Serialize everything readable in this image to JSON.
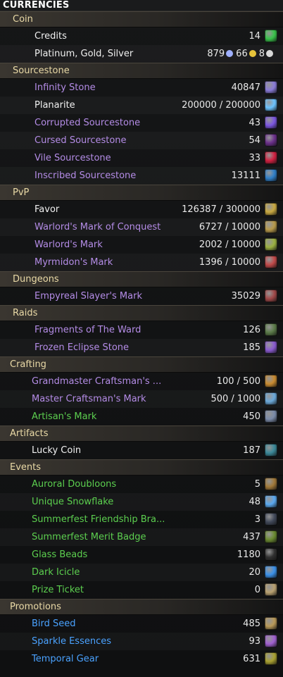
{
  "title": "CURRENCIES",
  "sections": {
    "coin": {
      "header": "Coin",
      "credits": {
        "label": "Credits",
        "value": "14",
        "icon": "green-gem-icon",
        "color": "#38c44a"
      },
      "money": {
        "label": "Platinum, Gold, Silver",
        "platinum": "879",
        "gold": "66",
        "silver": "8"
      }
    },
    "sourcestone": {
      "header": "Sourcestone",
      "items": [
        {
          "label": "Infinity Stone",
          "value": "40847",
          "icon": "infinity-stone-icon",
          "color": "#8a7bd8"
        },
        {
          "label": "Planarite",
          "value": "200000 / 200000",
          "icon": "planarite-icon",
          "color": "#6cc3ff"
        },
        {
          "label": "Corrupted Sourcestone",
          "value": "43",
          "icon": "corrupted-sourcestone-icon",
          "color": "#7a55e0"
        },
        {
          "label": "Cursed Sourcestone",
          "value": "54",
          "icon": "cursed-sourcestone-icon",
          "color": "#6a2f8a"
        },
        {
          "label": "Vile Sourcestone",
          "value": "33",
          "icon": "vile-sourcestone-icon",
          "color": "#d02040"
        },
        {
          "label": "Inscribed Sourcestone",
          "value": "13111",
          "icon": "inscribed-sourcestone-icon",
          "color": "#2f7fc8"
        }
      ]
    },
    "pvp": {
      "header": "PvP",
      "items": [
        {
          "label": "Favor",
          "value": "126387 / 300000",
          "icon": "favor-icon",
          "color": "#c8a840"
        },
        {
          "label": "Warlord's Mark of Conquest",
          "value": "6727 / 10000",
          "icon": "conquest-mark-icon",
          "color": "#b89a4a"
        },
        {
          "label": "Warlord's Mark",
          "value": "2002 / 10000",
          "icon": "warlord-mark-icon",
          "color": "#9bb040"
        },
        {
          "label": "Myrmidon's Mark",
          "value": "1396 / 10000",
          "icon": "myrmidon-mark-icon",
          "color": "#c04848"
        }
      ]
    },
    "dungeons": {
      "header": "Dungeons",
      "items": [
        {
          "label": "Empyreal Slayer's Mark",
          "value": "35029",
          "icon": "slayer-mark-icon",
          "color": "#a04848"
        }
      ]
    },
    "raids": {
      "header": "Raids",
      "items": [
        {
          "label": "Fragments of The Ward",
          "value": "126",
          "icon": "ward-fragment-icon",
          "color": "#5a7a48"
        },
        {
          "label": "Frozen Eclipse Stone",
          "value": "185",
          "icon": "eclipse-stone-icon",
          "color": "#8a5ad0"
        }
      ]
    },
    "crafting": {
      "header": "Crafting",
      "items": [
        {
          "label": "Grandmaster Craftsman's ...",
          "value": "100 / 500",
          "icon": "grandmaster-mark-icon",
          "color": "#c88a30"
        },
        {
          "label": "Master Craftsman's Mark",
          "value": "500 / 1000",
          "icon": "master-mark-icon",
          "color": "#6aa8d8"
        },
        {
          "label": "Artisan's Mark",
          "value": "450",
          "icon": "artisan-mark-icon",
          "color": "#7a8aa8"
        }
      ]
    },
    "artifacts": {
      "header": "Artifacts",
      "items": [
        {
          "label": "Lucky Coin",
          "value": "187",
          "icon": "lucky-coin-icon",
          "color": "#3a8898"
        }
      ]
    },
    "events": {
      "header": "Events",
      "items": [
        {
          "label": "Auroral Doubloons",
          "value": "5",
          "icon": "doubloon-icon",
          "color": "#a07838"
        },
        {
          "label": "Unique Snowflake",
          "value": "48",
          "icon": "snowflake-icon",
          "color": "#5aa8f0"
        },
        {
          "label": "Summerfest Friendship Bra...",
          "value": "3",
          "icon": "friendship-bracelet-icon",
          "color": "#404858"
        },
        {
          "label": "Summerfest Merit Badge",
          "value": "437",
          "icon": "merit-badge-icon",
          "color": "#6a8a30"
        },
        {
          "label": "Glass Beads",
          "value": "1180",
          "icon": "glass-beads-icon",
          "color": "#303030"
        },
        {
          "label": "Dark Icicle",
          "value": "20",
          "icon": "icicle-icon",
          "color": "#3a90e8"
        },
        {
          "label": "Prize Ticket",
          "value": "0",
          "icon": "ticket-icon",
          "color": "#b8a070"
        }
      ]
    },
    "promotions": {
      "header": "Promotions",
      "items": [
        {
          "label": "Bird Seed",
          "value": "485",
          "icon": "bird-seed-icon",
          "color": "#b89858"
        },
        {
          "label": "Sparkle Essences",
          "value": "93",
          "icon": "sparkle-essence-icon",
          "color": "#a060d0"
        },
        {
          "label": "Temporal Gear",
          "value": "631",
          "icon": "temporal-gear-icon",
          "color": "#a8a030"
        }
      ]
    }
  },
  "colors": {
    "header_text": "#e9d9a6",
    "white_text": "#f0f0f0",
    "purple_text": "#b48ce6",
    "green_text": "#5ccf4f",
    "blue_text": "#4aa2ff",
    "platinum_coin": "#9fb0ff",
    "gold_coin": "#e6c23a",
    "silver_coin": "#d8d8d8"
  }
}
